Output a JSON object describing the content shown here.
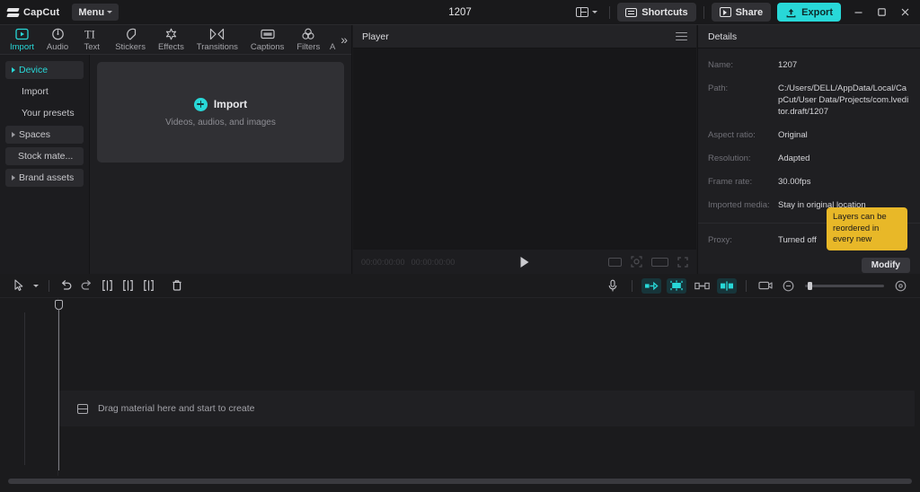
{
  "titlebar": {
    "app_name": "CapCut",
    "menu_label": "Menu",
    "project_title": "1207",
    "layout_icon": "layout-icon",
    "shortcuts_label": "Shortcuts",
    "share_label": "Share",
    "export_label": "Export",
    "minimize_label": "─",
    "maximize_label": "□",
    "close_label": "✕",
    "accent_color": "#28d8d8"
  },
  "nav_tabs": [
    {
      "label": "Import",
      "icon": "import-icon",
      "active": true
    },
    {
      "label": "Audio",
      "icon": "audio-icon",
      "active": false
    },
    {
      "label": "Text",
      "icon": "text-icon",
      "active": false
    },
    {
      "label": "Stickers",
      "icon": "stickers-icon",
      "active": false
    },
    {
      "label": "Effects",
      "icon": "effects-icon",
      "active": false
    },
    {
      "label": "Transitions",
      "icon": "transitions-icon",
      "active": false
    },
    {
      "label": "Captions",
      "icon": "captions-icon",
      "active": false
    },
    {
      "label": "Filters",
      "icon": "filters-icon",
      "active": false
    },
    {
      "label": "A",
      "icon": "adjustment-icon",
      "active": false
    }
  ],
  "nav_overflow_label": "»",
  "sidebar": {
    "items": [
      {
        "label": "Device",
        "selected": true,
        "expandable": true,
        "boxed": true
      },
      {
        "label": "Import",
        "selected": false,
        "expandable": false,
        "boxed": false
      },
      {
        "label": "Your presets",
        "selected": false,
        "expandable": false,
        "boxed": false
      },
      {
        "label": "Spaces",
        "selected": false,
        "expandable": true,
        "boxed": true
      },
      {
        "label": "Stock mate...",
        "selected": false,
        "expandable": false,
        "boxed": true
      },
      {
        "label": "Brand assets",
        "selected": false,
        "expandable": true,
        "boxed": true
      }
    ]
  },
  "dropzone": {
    "title": "Import",
    "subtitle": "Videos, audios, and images",
    "plus_icon": "plus-circle-icon"
  },
  "player": {
    "title": "Player",
    "menu_icon": "hamburger-icon",
    "current_time": "00:00:00:00",
    "total_time": "00:00:00:00",
    "fps_badge": "",
    "play_icon": "play-icon",
    "controls": [
      {
        "icon": "aspect-ratio-icon"
      },
      {
        "icon": "zoom-fit-icon"
      },
      {
        "icon": "screen-size-icon"
      },
      {
        "icon": "fullscreen-icon"
      }
    ]
  },
  "details": {
    "title": "Details",
    "rows": [
      {
        "key": "Name:",
        "value": "1207"
      },
      {
        "key": "Path:",
        "value": "C:/Users/DELL/AppData/Local/CapCut/User Data/Projects/com.lveditor.draft/1207"
      },
      {
        "key": "Aspect ratio:",
        "value": "Original"
      },
      {
        "key": "Resolution:",
        "value": "Adapted"
      },
      {
        "key": "Frame rate:",
        "value": "30.00fps"
      },
      {
        "key": "Imported media:",
        "value": "Stay in original location"
      },
      {
        "key": "Proxy:",
        "value": "Turned off"
      }
    ],
    "modify_label": "Modify",
    "tooltip_text": "Layers can be reordered in every new",
    "tooltip_color": "#e8b828"
  },
  "timeline": {
    "tools": [
      {
        "icon": "cursor-select-icon"
      },
      {
        "icon": "chevron-down-icon"
      },
      {
        "icon": "undo-icon"
      },
      {
        "icon": "redo-icon"
      },
      {
        "icon": "split-icon"
      },
      {
        "icon": "trim-left-icon"
      },
      {
        "icon": "trim-right-icon"
      },
      {
        "icon": "delete-icon"
      }
    ],
    "right_tools": [
      {
        "icon": "microphone-icon",
        "active": false
      },
      {
        "icon": "mirror-icon",
        "active": true
      },
      {
        "icon": "snap-icon",
        "active": true
      },
      {
        "icon": "link-icon",
        "active": false
      },
      {
        "icon": "adjust-icon",
        "active": true
      },
      {
        "icon": "preview-icon",
        "active": false
      }
    ],
    "zoom_out_icon": "zoom-out-icon",
    "zoom_in_icon": "zoom-in-icon",
    "drag_hint": "Drag material here and start to create",
    "clip_icon": "clip-icon",
    "playhead_icon": "playhead-handle-icon"
  }
}
